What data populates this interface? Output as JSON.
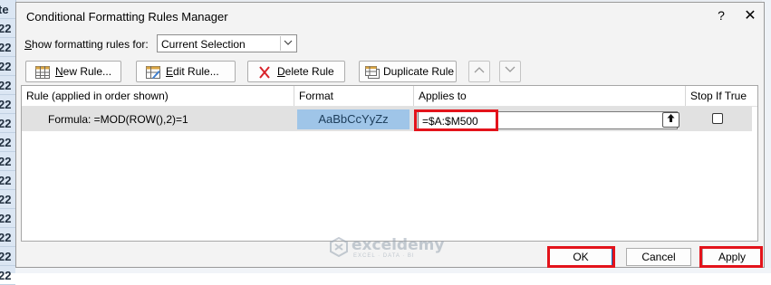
{
  "sheet": {
    "row_labels": [
      "te",
      "22",
      "22",
      "22",
      "22",
      "22",
      "22",
      "22",
      "22",
      "22",
      "22",
      "22",
      "22",
      "22",
      "22"
    ]
  },
  "dialog": {
    "title": "Conditional Formatting Rules Manager",
    "help_label": "?",
    "close_label": "✕"
  },
  "scope": {
    "label_prefix": "",
    "label_underlined": "S",
    "label_rest": "how formatting rules for:",
    "value": "Current Selection"
  },
  "toolbar": {
    "new_rule": {
      "underlined": "N",
      "rest": "ew Rule..."
    },
    "edit_rule": {
      "underlined": "E",
      "rest": "dit Rule..."
    },
    "delete_rule": {
      "underlined": "D",
      "rest": "elete Rule"
    },
    "duplicate_rule": {
      "underlined": "",
      "rest": "Duplicate Rule"
    },
    "move_up": "⌃",
    "move_down": "⌄"
  },
  "columns": {
    "rule": "Rule (applied in order shown)",
    "format": "Format",
    "applies_to": "Applies to",
    "stop_if_true": "Stop If True"
  },
  "rules": [
    {
      "rule": "Formula: =MOD(ROW(),2)=1",
      "format_preview": "AaBbCcYyZz",
      "applies_to": "=$A:$M500",
      "stop_if_true": false
    }
  ],
  "buttons": {
    "ok": "OK",
    "cancel": "Cancel",
    "apply": "Apply"
  },
  "watermark": {
    "name": "exceldemy",
    "tagline": "EXCEL · DATA · BI"
  },
  "colors": {
    "highlight": "#e3131b",
    "format_preview": "#9fc5e8",
    "selected_row": "#e1e1e1"
  }
}
